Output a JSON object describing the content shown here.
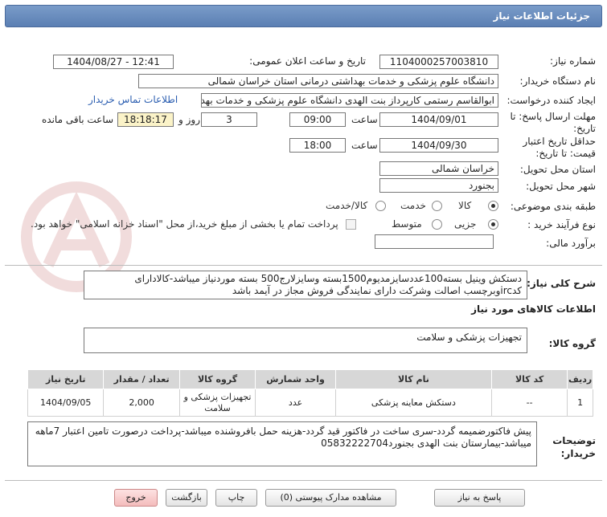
{
  "header": {
    "title": "جزئیات اطلاعات نیاز"
  },
  "form": {
    "need_number_label": "شماره نیاز:",
    "need_number": "1104000257003810",
    "announce_label": "تاریخ و ساعت اعلان عمومی:",
    "announce_value": "1404/08/27 - 12:41",
    "buyer_label": "نام دستگاه خریدار:",
    "buyer_value": "دانشگاه علوم پزشکی و خدمات بهداشتی درمانی استان خراسان شمالی",
    "creator_label": "ایجاد کننده درخواست:",
    "creator_value": "ابوالقاسم رستمی کارپرداز بنت الهدی دانشگاه علوم پزشکی و خدمات بهداشتی",
    "contact_link": "اطلاعات تماس خریدار",
    "deadline_label": "مهلت ارسال پاسخ: تا تاریخ:",
    "deadline_date": "1404/09/01",
    "time_label": "ساعت",
    "deadline_time": "09:00",
    "days_value": "3",
    "days_label": "روز و",
    "remaining_time": "18:18:17",
    "remaining_label": "ساعت باقی مانده",
    "validity_label": "حداقل تاریخ اعتبار قیمت: تا تاریخ:",
    "validity_date": "1404/09/30",
    "validity_time": "18:00",
    "province_label": "استان محل تحویل:",
    "province_value": "خراسان شمالی",
    "city_label": "شهر محل تحویل:",
    "city_value": "بجنورد",
    "category_label": "طبقه بندی موضوعی:",
    "category_options": [
      "کالا",
      "خدمت",
      "کالا/خدمت"
    ],
    "category_selected": 0,
    "process_label": "نوع فرآیند خرید :",
    "process_options": [
      "جزیی",
      "متوسط"
    ],
    "process_selected": 0,
    "payment_text": "پرداخت تمام یا بخشی از مبلغ خرید،از محل \"اسناد خزانه اسلامی\" خواهد بود.",
    "estimate_label": "برآورد مالی:",
    "estimate_value": ""
  },
  "description": {
    "label": "شرح کلی نیاز:",
    "text": "دستکش وینیل بسته100عددسایزمدیوم1500بسته وسایزلارج500 بسته موردنیاز میباشد-کالادارای کدircوبرچسب اصالت وشرکت دارای نمایندگی فروش مجاز در آیمد باشد"
  },
  "goods_info": {
    "title": "اطلاعات کالاهای مورد نیاز",
    "group_label": "گروه کالا:",
    "group_value": "تجهیزات پزشکی و سلامت"
  },
  "table": {
    "headers": [
      "ردیف",
      "کد کالا",
      "نام کالا",
      "واحد شمارش",
      "گروه کالا",
      "تعداد / مقدار",
      "تاریخ نیاز"
    ],
    "rows": [
      {
        "row": "1",
        "code": "--",
        "name": "دستکش معاینه پزشکی",
        "unit": "عدد",
        "group": "تجهیزات پزشکی و سلامت",
        "qty": "2,000",
        "date": "1404/09/05"
      }
    ]
  },
  "buyer_notes": {
    "label": "توضیحات خریدار:",
    "text": "پیش فاکتورضمیمه گردد-سری ساخت در فاکتور قید گردد-هزینه حمل بافروشنده میباشد-پرداخت درصورت تامین اعتبار 7ماهه میباشد-بیمارستان بنت الهدی بجنورد05832222704"
  },
  "buttons": {
    "reply": "پاسخ به نیاز",
    "attachments": "مشاهده مدارک پیوستی (0)",
    "print": "چاپ",
    "back": "بازگشت",
    "exit": "خروج"
  },
  "colors": {
    "header": "#5b7fb3",
    "link": "#2a5db0",
    "highlight": "#fbf3c8",
    "exit_button": "#f4bcbc"
  }
}
